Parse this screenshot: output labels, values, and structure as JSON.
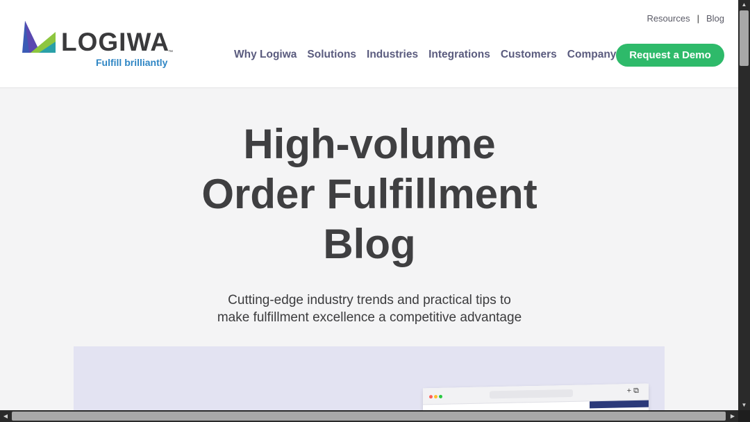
{
  "brand": {
    "name": "LOGIWA",
    "trademark": "™",
    "tagline": "Fulfill brilliantly",
    "colors": {
      "dark": "#3a3a3c",
      "tagline": "#2f86c4",
      "mark_blue": "#3b5bb5",
      "mark_green": "#8dc63f"
    }
  },
  "util_nav": {
    "resources": "Resources",
    "separator": "|",
    "blog": "Blog"
  },
  "main_nav": {
    "items": [
      "Why Logiwa",
      "Solutions",
      "Industries",
      "Integrations",
      "Customers",
      "Company"
    ]
  },
  "cta": {
    "label": "Request a Demo",
    "color": "#2eba6a"
  },
  "hero": {
    "title_lines": [
      "High-volume",
      "Order Fulfillment",
      "Blog"
    ],
    "subtitle_lines": [
      "Cutting-edge industry trends and practical tips to",
      "make fulfillment excellence a competitive advantage"
    ]
  },
  "hero_image": {
    "mock_icons": "+ ⧉"
  },
  "scrollbars": {
    "up_arrow": "▲",
    "down_arrow": "▼",
    "left_arrow": "◀",
    "right_arrow": "▶"
  }
}
